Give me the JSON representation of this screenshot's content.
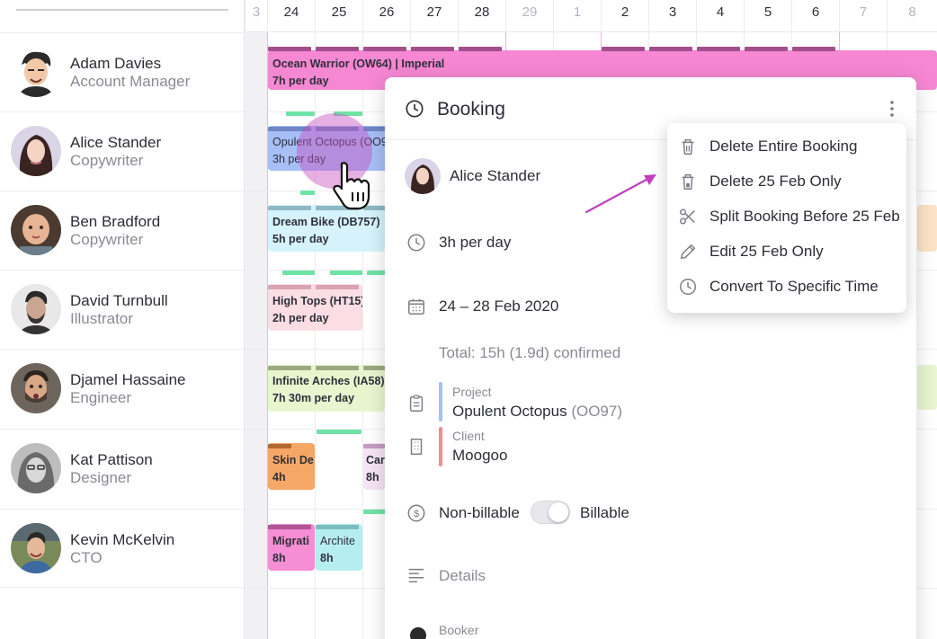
{
  "header": {
    "dates": [
      "3",
      "24",
      "25",
      "26",
      "27",
      "28",
      "29",
      "1",
      "2",
      "3",
      "4",
      "5",
      "6",
      "7",
      "8"
    ]
  },
  "people": [
    {
      "name": "Adam Davies",
      "role": "Account Manager"
    },
    {
      "name": "Alice Stander",
      "role": "Copywriter"
    },
    {
      "name": "Ben Bradford",
      "role": "Copywriter"
    },
    {
      "name": "David Turnbull",
      "role": "Illustrator"
    },
    {
      "name": "Djamel Hassaine",
      "role": "Engineer"
    },
    {
      "name": "Kat Pattison",
      "role": "Designer"
    },
    {
      "name": "Kevin McKelvin",
      "role": "CTO"
    }
  ],
  "bookings": [
    {
      "title": "Ocean Warrior (OW64) | Imperial",
      "hours": "7h per day",
      "color": "#f587d3"
    },
    {
      "title": "Opulent Octopus (OO97)",
      "hours": "3h per day",
      "color": "#a7bff7"
    },
    {
      "title": "Dream Bike (DB757)",
      "hours": "5h per day",
      "color": "#d6f3fb"
    },
    {
      "title": "High Tops (HT15)",
      "hours": "2h per day",
      "color": "#fbdde4"
    },
    {
      "title": "Infinite Arches (IA58)",
      "hours": "7h 30m per day",
      "color": "#e7f6cf"
    },
    {
      "title": "Skin De",
      "hours": "4h",
      "color": "#f5a866"
    },
    {
      "title": "Car",
      "hours": "8h",
      "color": "#f6e3f5"
    },
    {
      "title": "Migrati",
      "hours": "8h",
      "color": "#f58ed5"
    },
    {
      "title": "Archite",
      "hours": "8h",
      "color": "#b6edf0"
    }
  ],
  "panel": {
    "title": "Booking",
    "person": "Alice Stander",
    "hours": "3h per day",
    "date_range": "24 – 28 Feb 2020",
    "total": "Total: 15h (1.9d) confirmed",
    "project_label": "Project",
    "project_name": "Opulent Octopus",
    "project_code": "(OO97)",
    "client_label": "Client",
    "client_name": "Moogoo",
    "billing_left": "Non-billable",
    "billing_right": "Billable",
    "details_label": "Details",
    "booker_label": "Booker"
  },
  "menu": {
    "items": [
      {
        "label": "Delete Entire Booking",
        "icon": "trash-icon"
      },
      {
        "label": "Delete 25 Feb Only",
        "icon": "trash-partial-icon"
      },
      {
        "label": "Split Booking Before 25 Feb",
        "icon": "scissors-icon"
      },
      {
        "label": "Edit 25 Feb Only",
        "icon": "pencil-icon"
      },
      {
        "label": "Convert To Specific Time",
        "icon": "clock-icon"
      }
    ]
  },
  "colors": {
    "accent": "#c13fbf",
    "project_bar": "#a7bff7",
    "client_bar": "#f08c8c",
    "week_line": "#e9b7dc",
    "tentative_bar": "#6fe3a6"
  }
}
